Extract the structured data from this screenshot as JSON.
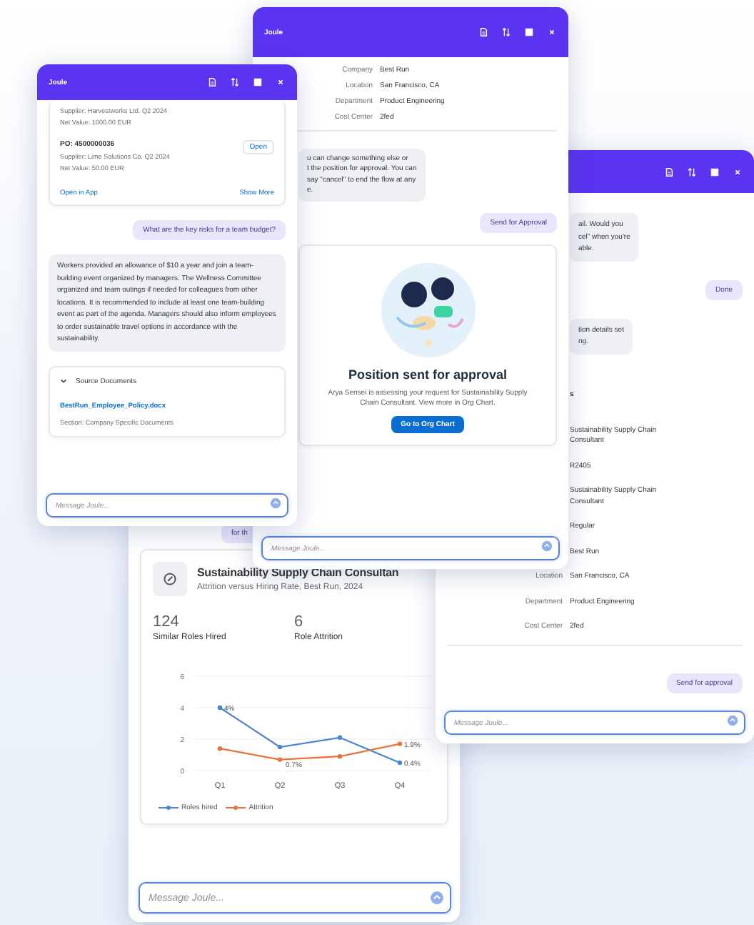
{
  "approval_chat": {
    "kind": "approval",
    "header": true,
    "title": "Joule",
    "fields": [
      {
        "label": "Company",
        "value": "Best Run"
      },
      {
        "label": "Location",
        "value": "San Francisco, CA"
      },
      {
        "label": "Department",
        "value": "Product Engineering"
      },
      {
        "label": "Cost Center",
        "value": "2fed"
      }
    ],
    "messages": [
      {
        "kind": "bot",
        "text": "u can change something else or\nt the position for approval. You can\nsay \"cancel\" to end the flow at any\ne."
      },
      {
        "kind": "user",
        "text": "Send for Approval"
      }
    ],
    "result": {
      "title": "Position sent for approval",
      "text": "Arya Sensei is assessing your request for Sustainability Supply Chain Consultant. View more in Org Chart.",
      "button": "Go to Org Chart"
    },
    "input": {
      "placeholder": "Message Joule..."
    }
  },
  "source_chat": {
    "kind": "sources",
    "header": true,
    "title": "Joule",
    "orders": [
      {
        "lines": [
          "Supplier: Harvestworks Ltd. Q2 2024",
          "Net Value: 1000.00 EUR"
        ]
      },
      {
        "number": "PO: 4500000036",
        "action": "Open",
        "lines": [
          "Supplier: Lime Solutions Co. Q2 2024",
          "Net Value: 50.00 EUR"
        ]
      }
    ],
    "links": [
      "Open in App",
      "Show More"
    ],
    "messages": [
      {
        "kind": "user",
        "text": "What are the key risks for a team budget?"
      },
      {
        "kind": "bot",
        "text": "Workers provided an allowance of $10 a year and join a team-building event organized by managers. The Wellness Committee organized and team outings if needed for colleagues from other locations. It is recommended to include at least one team-building event as part of the agenda. Managers should also inform employees to order sustainable travel options in accordance with the sustainability."
      }
    ],
    "sources": {
      "title": "Source Documents",
      "expanded": true,
      "document": "BestRun_Employee_Policy.docx",
      "section": "Section: Company Specific Documents"
    },
    "input": {
      "placeholder": "Message Joule..."
    }
  },
  "details_chat": {
    "kind": "details",
    "header": true,
    "messages": [
      {
        "kind": "bot",
        "text": "ail. Would you\ncel\" when you're\nable."
      },
      {
        "kind": "user",
        "text": "Done"
      },
      {
        "kind": "bot",
        "text": "tion details set\nng."
      }
    ],
    "heading": "s",
    "fields": [
      {
        "value": "Sustainability Supply Chain Consultant"
      },
      {
        "value": "R2405"
      },
      {
        "value": "Sustainability Supply Chain Consultant"
      },
      {
        "value": "Regular"
      },
      {
        "value": "Best Run"
      },
      {
        "label": "Location",
        "value": "San Francisco, CA"
      },
      {
        "label": "Department",
        "value": "Product Engineering"
      },
      {
        "label": "Cost Center",
        "value": "2fed"
      }
    ],
    "request": "Send for approval",
    "input": {
      "placeholder": "Message Joule..."
    }
  },
  "analytics_chat": {
    "kind": "analytics",
    "messages": [
      {
        "kind": "user",
        "text": "for th"
      }
    ],
    "card": {
      "title": "Sustainability Supply Chain Consultan",
      "subtitle": "Attrition versus Hiring Rate, Best Run, 2024",
      "kpis": [
        {
          "value": "124",
          "label": "Similar Roles Hired"
        },
        {
          "value": "6",
          "label": "Role Attrition"
        }
      ],
      "chart_data": {
        "type": "line",
        "categories": [
          "Q1",
          "Q2",
          "Q3",
          "Q4"
        ],
        "ylim": [
          0,
          6
        ],
        "yticks": [
          0,
          2,
          4,
          6
        ],
        "legend": true,
        "series": [
          {
            "name": "Roles hired",
            "color": "#4a86d4",
            "marker": "circle",
            "values": [
              4,
              1.5,
              2.1,
              0.5
            ]
          },
          {
            "name": "Attrition",
            "color": "#e8743b",
            "marker": "circle",
            "values": [
              1.4,
              0.7,
              0.9,
              1.7
            ]
          }
        ],
        "annotations": [
          {
            "x": "Q1",
            "y": 4,
            "text": "4%"
          },
          {
            "x": "Q2",
            "y": 0.7,
            "text": "0.7%"
          },
          {
            "x": "Q4",
            "y": 1.7,
            "text": "1.9%"
          },
          {
            "x": "Q4",
            "y": 0.5,
            "text": "0.4%"
          }
        ]
      }
    },
    "input": {
      "placeholder": "Message Joule..."
    }
  }
}
